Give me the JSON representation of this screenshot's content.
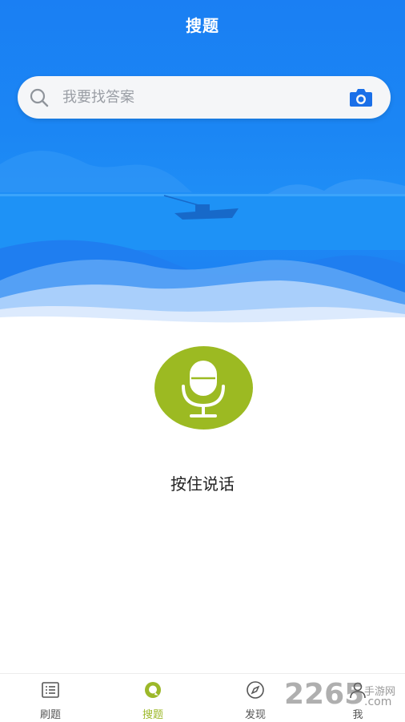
{
  "header": {
    "title": "搜题"
  },
  "search": {
    "placeholder": "我要找答案",
    "search_icon": "search-icon",
    "camera_icon": "camera-icon"
  },
  "voice": {
    "label": "按住说话",
    "icon": "microphone-icon"
  },
  "tabbar": {
    "active_color": "#9cb829",
    "items": [
      {
        "label": "刷题",
        "icon": "list-icon"
      },
      {
        "label": "搜题",
        "icon": "search-bubble-icon"
      },
      {
        "label": "发现",
        "icon": "compass-icon"
      },
      {
        "label": "我",
        "icon": "user-icon"
      }
    ]
  },
  "watermark": {
    "number": "2265",
    "site_name": "手游网",
    "domain": ".com"
  },
  "colors": {
    "hero_blue": "#1b86f4",
    "mic_green": "#9cba22",
    "camera_blue": "#1a6fe8"
  }
}
